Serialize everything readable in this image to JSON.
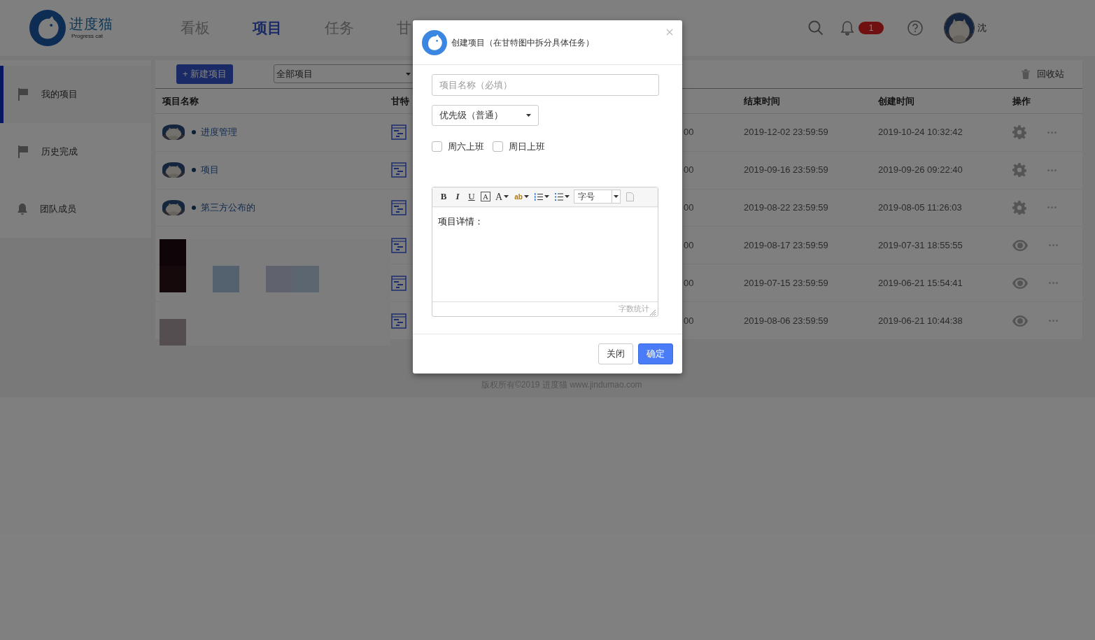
{
  "header": {
    "logo": {
      "name": "进度猫",
      "subtitle": "Progress cat"
    },
    "nav": [
      {
        "label": "看板",
        "selected": false
      },
      {
        "label": "项目",
        "selected": true
      },
      {
        "label": "任务",
        "selected": false
      },
      {
        "label": "甘",
        "selected": false
      }
    ],
    "notification_badge": "1",
    "user_name": "沈"
  },
  "sidebar": {
    "items": [
      {
        "label": "我的项目",
        "kind": "flag",
        "selected": true
      },
      {
        "label": "历史完成",
        "kind": "flag",
        "selected": false
      },
      {
        "label": "团队成员",
        "kind": "bell",
        "selected": false
      }
    ]
  },
  "toolbar": {
    "new_button": "+ 新建项目",
    "filter": "全部项目",
    "recycle_bin": "回收站"
  },
  "table": {
    "columns": [
      "项目名称",
      "甘特",
      "结束时间",
      "创建时间",
      "操作"
    ],
    "rows": [
      {
        "name": "进度管理",
        "column_3": "00",
        "end": "2019-12-02 23:59:59",
        "created": "2019-10-24 10:32:42",
        "kind": "settings"
      },
      {
        "name": "项目",
        "column_3": "00",
        "end": "2019-09-16 23:59:59",
        "created": "2019-09-26 09:22:40",
        "kind": "settings"
      },
      {
        "name": "第三方公布的",
        "column_3": "00",
        "end": "2019-08-22 23:59:59",
        "created": "2019-08-05 11:26:03",
        "kind": "settings"
      },
      {
        "column_3": "00",
        "end": "2019-08-17 23:59:59",
        "created": "2019-07-31 18:55:55",
        "kind": "view"
      },
      {
        "column_3": "00",
        "end": "2019-07-15 23:59:59",
        "created": "2019-06-21 15:54:41",
        "kind": "view"
      },
      {
        "column_3": "00",
        "end": "2019-08-06 23:59:59",
        "created": "2019-06-21 10:44:38",
        "kind": "view"
      }
    ]
  },
  "footer": "版权所有©2019 进度猫 www.jindumao.com",
  "dialog": {
    "title": "创建项目（在甘特图中拆分具体任务）",
    "name_placeholder": "项目名称（必填）",
    "priority": "优先级（普通）",
    "checkboxes": [
      {
        "label": "周六上班",
        "checked": false
      },
      {
        "label": "周日上班",
        "checked": false
      }
    ],
    "editor": {
      "toolbar": [
        {
          "kind": "bold",
          "label": "B"
        },
        {
          "kind": "italic",
          "label": "I"
        },
        {
          "kind": "underline",
          "label": "U"
        },
        {
          "kind": "boxed",
          "label": "A"
        },
        {
          "kind": "color",
          "label": "A"
        },
        {
          "kind": "highlight",
          "label": "ab"
        },
        {
          "kind": "ordered"
        },
        {
          "kind": "unordered"
        },
        {
          "kind": "size",
          "label": "字号"
        },
        {
          "kind": "page"
        }
      ],
      "content": "项目详情：",
      "word_count": "字数统计"
    },
    "buttons": [
      {
        "label": "关闭",
        "kind": "secondary"
      },
      {
        "label": "确定",
        "kind": "primary"
      }
    ]
  }
}
